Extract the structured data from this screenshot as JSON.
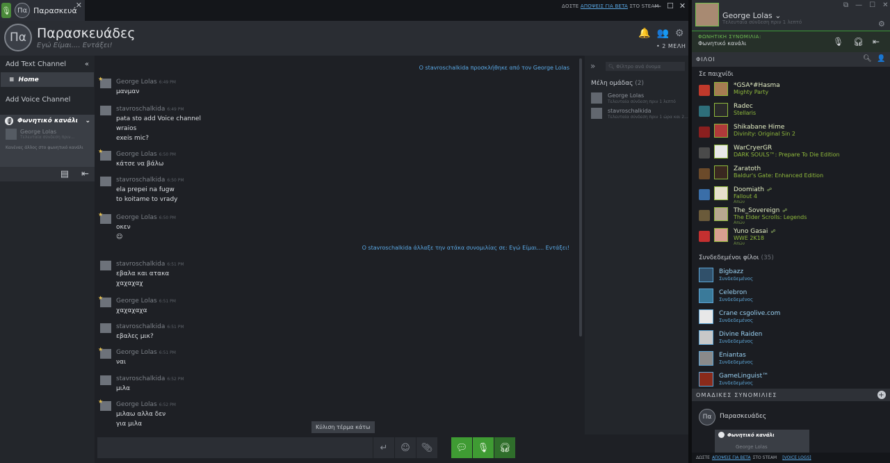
{
  "tab": {
    "title": "Παρασκευάδες",
    "avatar": "Πα"
  },
  "beta": {
    "pre": "ΔΟΣΤΕ",
    "link": "ΑΠΟΨΕΙΣ ΓΙΑ BETA",
    "post": "ΣΤΟ STEAM"
  },
  "group": {
    "avatar": "Πα",
    "title": "Παρασκευάδες",
    "subtitle": "Εγώ Είμαι.... Εντάξει!",
    "members": "• 2 ΜΕΛΗ"
  },
  "channels": {
    "add_text": "Add Text Channel",
    "home": "Home",
    "add_voice": "Add Voice Channel",
    "voice_name": "Φωνητικό κανάλι",
    "voice_user": "George Lolas",
    "voice_user_note": "Τελευταία σύνδεση πριν...",
    "speaking": "Κανένας άλλος στο φωνητικό κανάλι"
  },
  "chat": {
    "system": [
      "O stavroschalkida προσκλήθηκε από τον George Lolas",
      "O stavroschalkida άλλαξε την ατάκα συνομιλίας σε: Εγώ Είμαι.... Εντάξει!"
    ],
    "messages": [
      {
        "name": "George Lolas",
        "time": "6:49 PM",
        "star": true,
        "lines": [
          "μανμαν"
        ]
      },
      {
        "name": "stavroschalkida",
        "time": "6:49 PM",
        "star": false,
        "lines": [
          "pata sto add Voice channel",
          "wraios",
          "exeis mic?"
        ]
      },
      {
        "name": "George Lolas",
        "time": "6:50 PM",
        "star": true,
        "lines": [
          "κάτσε να βάλω"
        ]
      },
      {
        "name": "stavroschalkida",
        "time": "6:50 PM",
        "star": false,
        "lines": [
          "ela prepei na fugw",
          "to koitame to vrady"
        ]
      },
      {
        "name": "George Lolas",
        "time": "6:50 PM",
        "star": true,
        "lines": [
          "οκεν",
          "☺"
        ]
      },
      {
        "name": "stavroschalkida",
        "time": "6:51 PM",
        "star": false,
        "lines": [
          "εβαλα και ατακα",
          "χαχαχαχ"
        ]
      },
      {
        "name": "George Lolas",
        "time": "6:51 PM",
        "star": true,
        "lines": [
          "χαχαχαχα"
        ]
      },
      {
        "name": "stavroschalkida",
        "time": "6:51 PM",
        "star": false,
        "lines": [
          "εβαλες μικ?"
        ]
      },
      {
        "name": "George Lolas",
        "time": "6:51 PM",
        "star": true,
        "lines": [
          "ναι"
        ]
      },
      {
        "name": "stavroschalkida",
        "time": "6:52 PM",
        "star": false,
        "lines": [
          "μιλα"
        ]
      },
      {
        "name": "George Lolas",
        "time": "6:52 PM",
        "star": true,
        "lines": [
          "μιλαω αλλα δεν",
          "για μιλα"
        ]
      }
    ],
    "scroll_tip": "Κύλιση τέρμα κάτω"
  },
  "members_panel": {
    "search_placeholder": "Φίλτρο ανά όνομα",
    "title": "Μέλη ομάδας",
    "count": "(2)",
    "members": [
      {
        "name": "George Lolas",
        "status": "Τελευταία σύνδεση πριν 1 λεπτό"
      },
      {
        "name": "stavroschalkida",
        "status": "Τελευταία σύνδεση πριν 1 ώρα και 2..."
      }
    ]
  },
  "friends": {
    "user": "George Lolas ⌄",
    "status": "Τελευταία σύνδεση πριν 1 λεπτό",
    "voice_label": "ΦΩΝΗΤΙΚΗ ΣΥΝΟΜΙΛΙΑ:",
    "voice_channel": "Φωνητικό κανάλι",
    "friends_bar": "ΦΙΛΟΙ",
    "in_game_head": "Σε παιχνίδι",
    "in_game": [
      {
        "name": "*GSA*#Hasma",
        "game": "Mighty Party",
        "extra": "",
        "cloud": false,
        "ico": "#c0392b",
        "av": "#a67c52"
      },
      {
        "name": "Radec",
        "game": "Stellaris",
        "extra": "",
        "cloud": false,
        "ico": "#2e6e7a",
        "av": "#2a2a2a"
      },
      {
        "name": "Shikabane Hime",
        "game": "Divinity: Original Sin 2",
        "extra": "",
        "cloud": false,
        "ico": "#8a1f1f",
        "av": "#b03a3a"
      },
      {
        "name": "WarCryerGR",
        "game": "DARK SOULS™: Prepare To Die Edition",
        "extra": "",
        "cloud": false,
        "ico": "#4a4a4a",
        "av": "#e8e8e8"
      },
      {
        "name": "Zaratoth",
        "game": "Baldur's Gate: Enhanced Edition",
        "extra": "",
        "cloud": false,
        "ico": "#6b4a2a",
        "av": "#3a2820"
      },
      {
        "name": "Doomiath",
        "game": "Fallout 4",
        "extra": "Απών",
        "cloud": true,
        "ico": "#3a6ea8",
        "av": "#e6e0cc"
      },
      {
        "name": "The_Sovereign",
        "game": "The Elder Scrolls: Legends",
        "extra": "Απών",
        "cloud": true,
        "ico": "#6a5a3a",
        "av": "#b8a890"
      },
      {
        "name": "Yuno Gasai",
        "game": "WWE 2K18",
        "extra": "Απών",
        "cloud": true,
        "ico": "#c43030",
        "av": "#d8a090"
      }
    ],
    "online_head": "Συνδεδεμένοι φίλοι",
    "online_count": "(35)",
    "online": [
      {
        "name": "Bigbazz",
        "status": "Συνδεδεμένος",
        "av": "#30506a"
      },
      {
        "name": "Celebron",
        "status": "Συνδεδεμένος",
        "av": "#3a7a9a"
      },
      {
        "name": "Crane csgolive.com",
        "status": "Συνδεδεμένος",
        "av": "#e8e8e8"
      },
      {
        "name": "Divine Raiden",
        "status": "Συνδεδεμένος",
        "av": "#c8c8c8"
      },
      {
        "name": "Eniantas",
        "status": "Συνδεδεμένος",
        "av": "#8a8a8a"
      },
      {
        "name": "GameLinguist™",
        "status": "Συνδεδεμένος",
        "av": "#8a2a1a"
      }
    ],
    "group_chats_bar": "ΟΜΑΔΙΚΕΣ ΣΥΝΟΜΙΛΙΕΣ",
    "group_chat": {
      "avatar": "Πα",
      "name": "Παρασκευάδες",
      "voice": "Φωνητικό κανάλι",
      "voice_user": "George Lolas"
    },
    "bottom": {
      "pre": "ΔΩΣΤΕ",
      "link": "ΑΠΟΨΕΙΣ ΓΙΑ BETA",
      "post": "ΣΤΟ STEAM",
      "logs": "[VOICE LOGS]"
    }
  }
}
